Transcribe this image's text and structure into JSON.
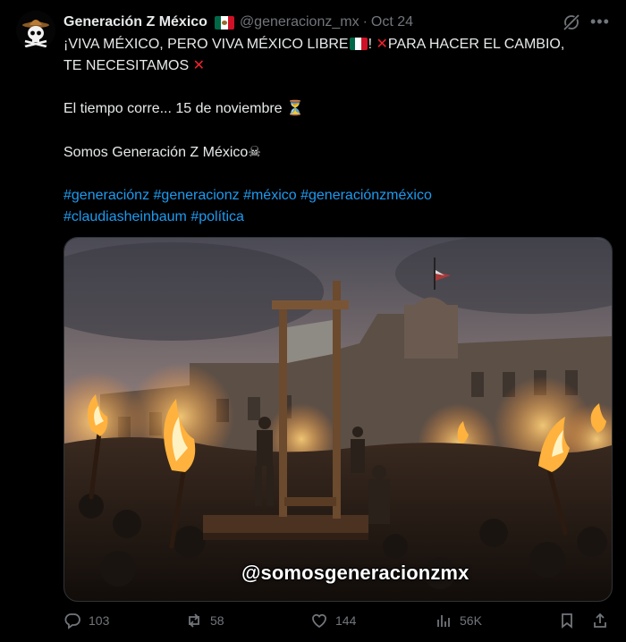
{
  "author": {
    "display_name": "Generación Z México",
    "handle": "@generacionz_mx",
    "date": "Oct 24",
    "separator": "·"
  },
  "tweet": {
    "line1_a": "¡VIVA MÉXICO, PERO VIVA MÉXICO LIBRE",
    "line1_b": "!",
    "line1_c": "PARA HACER EL CAMBIO,",
    "line2": "TE NECESITAMOS",
    "x_mark": "✕",
    "line3": "El tiempo corre... 15 de noviembre",
    "hourglass": "⏳",
    "line4": "Somos Generación Z México",
    "skull": "☠",
    "hashtags_line1": [
      "#generaciónz",
      "#generacionz",
      "#méxico",
      "#generaciónzméxico"
    ],
    "hashtags_line2": [
      "#claudiasheinbaum",
      "#política"
    ]
  },
  "media": {
    "watermark": "@somosgeneracionzmx"
  },
  "actions": {
    "replies": "103",
    "reposts": "58",
    "likes": "144",
    "views": "56K"
  },
  "colors": {
    "background": "#000000",
    "text": "#e7e9ea",
    "muted": "#71767b",
    "link": "#1d9bf0",
    "x_red": "#f4212e",
    "flag_green": "#006847",
    "flag_white": "#ffffff",
    "flag_red": "#ce1126"
  },
  "icons": {
    "avatar": "skull-hat-avatar",
    "grok": "grok-icon",
    "more": "more-icon",
    "reply": "reply-icon",
    "repost": "repost-icon",
    "like": "heart-icon",
    "views": "views-icon",
    "bookmark": "bookmark-icon",
    "share": "share-icon"
  }
}
